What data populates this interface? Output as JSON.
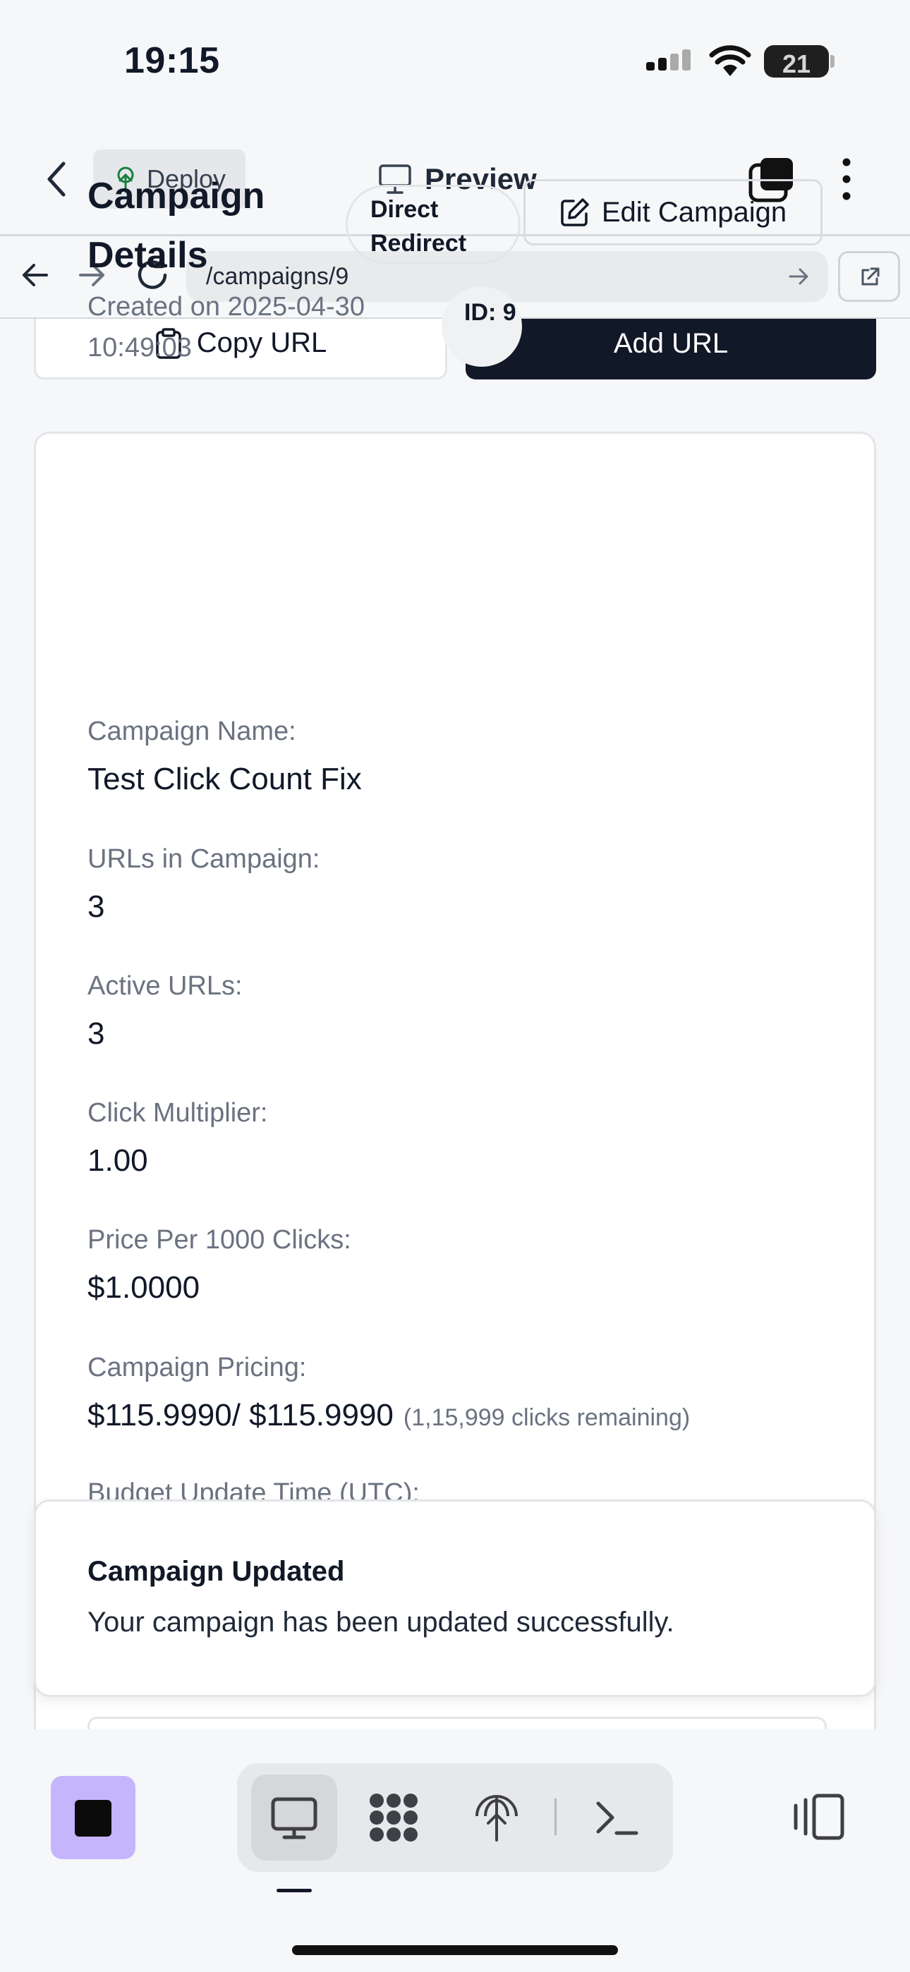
{
  "status_bar": {
    "time": "19:15",
    "battery": "21"
  },
  "header": {
    "deploy_label": "Deploy",
    "preview_label": "Preview"
  },
  "browser": {
    "url": "/campaigns/9"
  },
  "actions": {
    "copy_url_label": "Copy URL",
    "add_url_label": "Add URL"
  },
  "campaign": {
    "title": "Campaign Details",
    "type_badge": "Direct Redirect",
    "edit_label": "Edit Campaign",
    "created": "Created on 2025-04-30 10:49:03",
    "id_label": "ID: 9",
    "fields": [
      {
        "label": "Campaign Name:",
        "value": "Test Click Count Fix"
      },
      {
        "label": "URLs in Campaign:",
        "value": "3"
      },
      {
        "label": "Active URLs:",
        "value": "3"
      },
      {
        "label": "Click Multiplier:",
        "value": "1.00"
      },
      {
        "label": "Price Per 1000 Clicks:",
        "value": "$1.0000"
      },
      {
        "label": "Campaign Pricing:",
        "value": "$115.9990/ $115.9990",
        "note": "(1,15,999 clicks remaining)"
      },
      {
        "label": "Budget Update Time (UTC):"
      }
    ]
  },
  "toast": {
    "title": "Campaign Updated",
    "description": "Your campaign has been updated successfully."
  },
  "dock": {
    "icons": [
      "stop-icon",
      "desktop-icon",
      "grid-icon",
      "antenna-icon",
      "terminal-icon",
      "panel-toggle-icon"
    ]
  },
  "colors": {
    "primary_dark": "#111827",
    "stop_bg": "#c4b5fd",
    "muted_text": "#6b7280"
  }
}
